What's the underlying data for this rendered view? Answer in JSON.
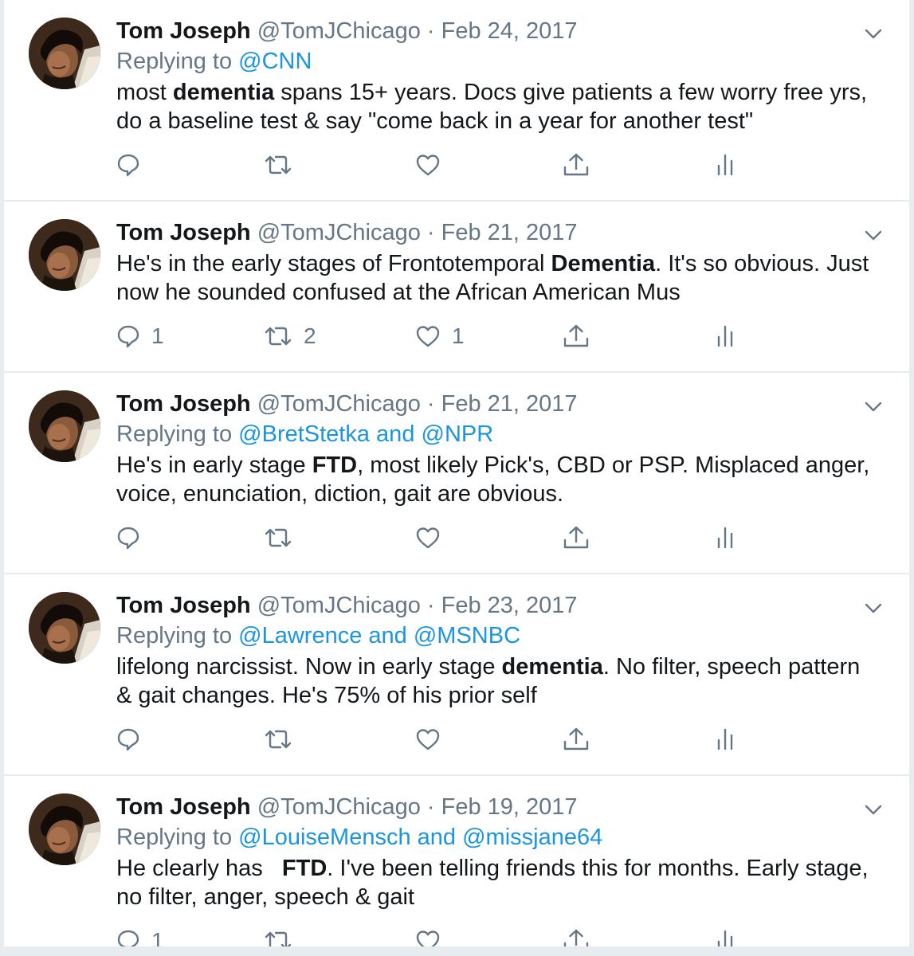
{
  "tweets": [
    {
      "name": "Tom Joseph",
      "handle": "@TomJChicago",
      "date": "Feb 24, 2017",
      "replying_prefix": "Replying to ",
      "replying_to_1": "@CNN",
      "replying_join": "",
      "replying_to_2": "",
      "text_before": "most ",
      "text_bold": "dementia",
      "text_after": " spans 15+ years. Docs give patients a few worry free yrs, do a baseline test & say \"come back in a year for another test\"",
      "replies": "",
      "retweets": "",
      "likes": ""
    },
    {
      "name": "Tom Joseph",
      "handle": "@TomJChicago",
      "date": "Feb 21, 2017",
      "replying_prefix": "",
      "replying_to_1": "",
      "replying_join": "",
      "replying_to_2": "",
      "text_before": "He's in the early stages of Frontotemporal ",
      "text_bold": "Dementia",
      "text_after": ". It's so obvious. Just now he sounded confused at the African American Mus",
      "replies": "1",
      "retweets": "2",
      "likes": "1"
    },
    {
      "name": "Tom Joseph",
      "handle": "@TomJChicago",
      "date": "Feb 21, 2017",
      "replying_prefix": "Replying to ",
      "replying_to_1": "@BretStetka",
      "replying_join": " and ",
      "replying_to_2": "@NPR",
      "text_before": "He's in early stage ",
      "text_bold": "FTD",
      "text_after": ", most likely Pick's, CBD or PSP. Misplaced anger, voice, enunciation, diction, gait are obvious.",
      "replies": "",
      "retweets": "",
      "likes": ""
    },
    {
      "name": "Tom Joseph",
      "handle": "@TomJChicago",
      "date": "Feb 23, 2017",
      "replying_prefix": "Replying to ",
      "replying_to_1": "@Lawrence",
      "replying_join": " and ",
      "replying_to_2": "@MSNBC",
      "text_before": "lifelong narcissist. Now in early stage ",
      "text_bold": "dementia",
      "text_after": ". No filter, speech pattern & gait changes. He's 75% of his prior self",
      "replies": "",
      "retweets": "",
      "likes": ""
    },
    {
      "name": "Tom Joseph",
      "handle": "@TomJChicago",
      "date": "Feb 19, 2017",
      "replying_prefix": "Replying to ",
      "replying_to_1": "@LouiseMensch",
      "replying_join": " and ",
      "replying_to_2": "@missjane64",
      "text_before": "He clearly has   ",
      "text_bold": "FTD",
      "text_after": ". I've been telling friends this for months. Early stage, no filter, anger, speech & gait",
      "replies": "1",
      "retweets": "",
      "likes": ""
    }
  ],
  "separator": " · ",
  "icons": {
    "reply": "speech-bubble-icon",
    "retweet": "retweet-arrows-icon",
    "like": "heart-icon",
    "share": "share-upload-icon",
    "analytics": "bar-chart-icon",
    "menu": "chevron-down-icon"
  },
  "colors": {
    "link": "#1b95e0",
    "meta": "#657786",
    "text": "#14171a",
    "divider": "#e6ecf0"
  }
}
